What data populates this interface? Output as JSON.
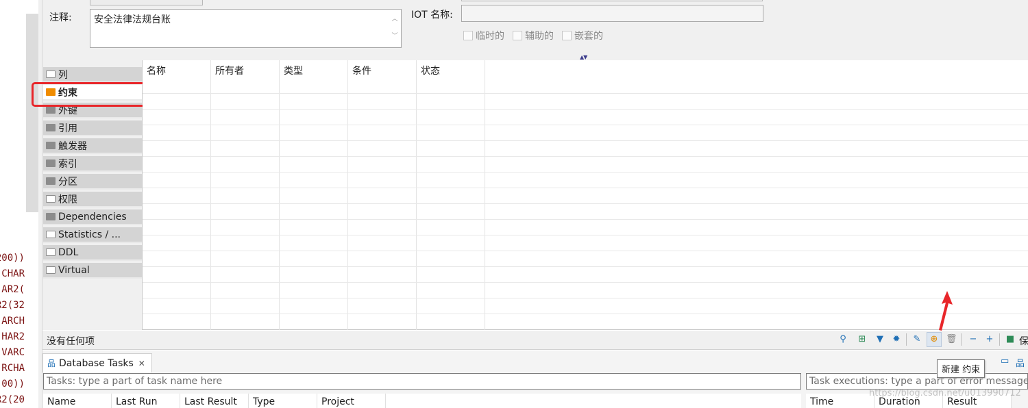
{
  "left_code": {
    "lines": [
      "200))",
      "CHAR",
      "AR2(",
      "R2(32",
      "ARCH",
      "HAR2",
      "VARC",
      "RCHA",
      "00))",
      "R2(20"
    ]
  },
  "properties": {
    "comment_label": "注释:",
    "comment_value": "安全法律法规台账",
    "iot_label": "IOT 名称:",
    "iot_value": "",
    "checkboxes": [
      {
        "label": "临时的",
        "checked": false
      },
      {
        "label": "辅助的",
        "checked": false
      },
      {
        "label": "嵌套的",
        "checked": false
      }
    ]
  },
  "tabs": [
    {
      "label": "列",
      "icon": "columns-icon",
      "active": false
    },
    {
      "label": "约束",
      "icon": "constraint-icon",
      "active": true
    },
    {
      "label": "外键",
      "icon": "folder-icon",
      "active": false
    },
    {
      "label": "引用",
      "icon": "folder-icon",
      "active": false
    },
    {
      "label": "触发器",
      "icon": "folder-icon",
      "active": false
    },
    {
      "label": "索引",
      "icon": "folder-icon",
      "active": false
    },
    {
      "label": "分区",
      "icon": "folder-icon",
      "active": false
    },
    {
      "label": "权限",
      "icon": "key-icon",
      "active": false
    },
    {
      "label": "Dependencies",
      "icon": "folder-icon",
      "active": false
    },
    {
      "label": "Statistics / ...",
      "icon": "info-icon",
      "active": false
    },
    {
      "label": "DDL",
      "icon": "ddl-icon",
      "active": false
    },
    {
      "label": "Virtual",
      "icon": "virtual-icon",
      "active": false
    }
  ],
  "constraints_table": {
    "columns": [
      "名称",
      "所有者",
      "类型",
      "条件",
      "状态"
    ],
    "rows": []
  },
  "status": {
    "text": "没有任何项"
  },
  "toolbar": {
    "save_label": "保",
    "tooltip": "新建 约束",
    "icons": [
      "search-icon",
      "tree-icon",
      "filter-icon",
      "settings-icon",
      "edit-icon",
      "new-constraint-icon",
      "delete-icon",
      "collapse-icon",
      "expand-icon",
      "save-icon"
    ]
  },
  "tasks_panel": {
    "tab_label": "Database Tasks",
    "task_placeholder": "Tasks: type a part of task name here",
    "exec_placeholder": "Task executions: type a part of error message",
    "task_columns": [
      "Name",
      "Last Run",
      "Last Result",
      "Type",
      "Project"
    ],
    "exec_columns": [
      "Time",
      "Duration",
      "Result"
    ]
  },
  "watermark": "https://blog.csdn.net/u013990712"
}
